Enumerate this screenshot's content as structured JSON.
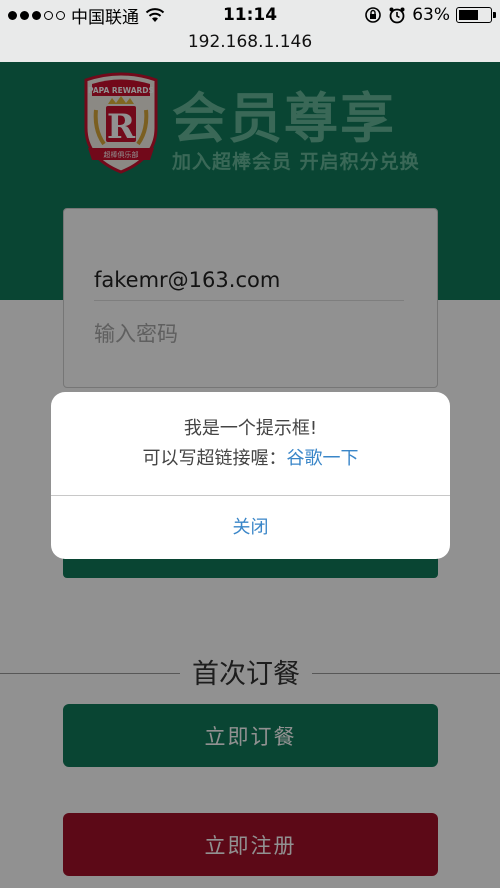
{
  "status_bar": {
    "carrier": "中国联通",
    "time": "11:14",
    "battery_percent_label": "63%",
    "battery_level": 0.63,
    "signal_icon": "signal-dots-icon",
    "wifi_icon": "wifi-icon",
    "lock_icon": "rotation-lock-icon",
    "alarm_icon": "alarm-icon"
  },
  "browser": {
    "url": "192.168.1.146"
  },
  "brand": {
    "logo_top_text": "PAPA REWARDS",
    "logo_letter": "R",
    "logo_ribbon_text": "超棒俱乐部",
    "title": "会员尊享",
    "subtitle": "加入超棒会员  开启积分兑换"
  },
  "login": {
    "email_value": "fakemr@163.com",
    "password_placeholder": "输入密码"
  },
  "first_order": {
    "label": "首次订餐",
    "order_button": "立即订餐",
    "register_button": "立即注册"
  },
  "dialog": {
    "line1": "我是一个提示框!",
    "line2_prefix": "可以写超链接喔：",
    "link_text": "谷歌一下",
    "close_label": "关闭"
  },
  "colors": {
    "brand_green": "#117a5a",
    "register_red": "#a3102a",
    "link_blue": "#3a86c8"
  }
}
